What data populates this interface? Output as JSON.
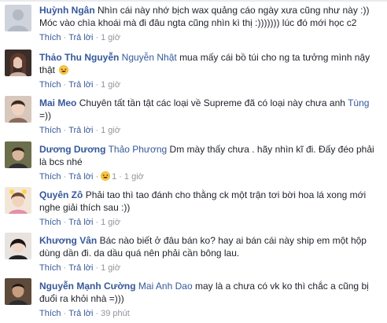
{
  "comments": [
    {
      "author": "Huỳnh Ngân",
      "mention": "",
      "text": "Nhìn cái này nhớ bịch wax quảng cáo ngày xưa cũng như này :)) Móc vào chìa khoái mà đi đâu ngta cũng nhìn kì thị :))))))) lúc đó mới học c2",
      "like": "Thích",
      "reply": "Trả lời",
      "time": "1 giờ"
    },
    {
      "author": "Thảo Thu Nguyễn",
      "mention": "Nguyễn Nhật",
      "text": "mua mấy cái bồ túi cho ng ta tưởng mình nậy thật",
      "emoji": "laughing-emoji",
      "like": "Thích",
      "reply": "Trả lời",
      "time": "1 giờ"
    },
    {
      "author": "Mai Meo",
      "mention": "",
      "text": "Chuyên tất tần tật các loại về Supreme đã có loại này chưa anh",
      "mention_after": "Tùng",
      "text_after": "=))",
      "like": "Thích",
      "reply": "Trả lời",
      "time": "1 giờ"
    },
    {
      "author": "Dương Dương",
      "mention": "Thảo Phương",
      "text": "Dm mày thấy chưa . hãy nhìn kĩ đi. Đấy đéo phải là bcs nhé",
      "like": "Thích",
      "reply": "Trả lời",
      "reactions": "1",
      "time": "1 giờ"
    },
    {
      "author": "Quyên Zô",
      "mention": "",
      "text": "Phải tao thì tao đánh cho thằng ck một trận tơi bời hoa lá xong mới nghe giải thích sau :))",
      "like": "Thích",
      "reply": "Trả lời",
      "time": "1 giờ"
    },
    {
      "author": "Khương Vân",
      "mention": "",
      "text": "Bác nào biết ở đâu bán ko? hay ai bán cái này ship em một hộp dùng dần đi. da dầu quá nên phải cần bông lau.",
      "like": "Thích",
      "reply": "Trả lời",
      "time": "1 giờ"
    },
    {
      "author": "Nguyễn Mạnh Cường",
      "mention": "Mai Anh Dao",
      "text": "may là a chưa có vk ko thì chắc a cũng bị đuổi ra khỏi nhà =)))",
      "like": "Thích",
      "reply": "Trả lời",
      "time": "39 phút"
    }
  ]
}
